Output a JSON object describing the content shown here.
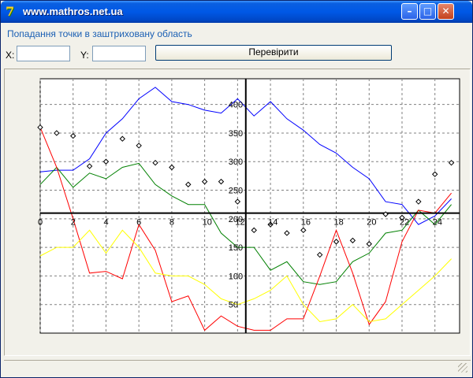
{
  "window": {
    "title": "www.mathros.net.ua",
    "icon": "app-logo-icon"
  },
  "header": {
    "caption": "Попадання точки в заштриховану область"
  },
  "form": {
    "x_label": "X:",
    "x_value": "",
    "y_label": "Y:",
    "y_value": "",
    "button_label": "Перевірити"
  },
  "colors": {
    "accent": "#0058e6",
    "caption": "#1a5fb4"
  },
  "chart_data": {
    "type": "line",
    "x_ticks": [
      "0",
      "2",
      "4",
      "6",
      "8",
      "10",
      "12",
      "14",
      "16",
      "18",
      "20",
      "22",
      "24"
    ],
    "y_ticks": [
      "50",
      "100",
      "150",
      "200",
      "250",
      "300",
      "350",
      "400"
    ],
    "xlim": [
      0,
      25.5
    ],
    "ylim": [
      0,
      445
    ],
    "x_axis_at_y": 210,
    "y_axis_at_x": 12.5,
    "grid": true,
    "x": [
      0,
      1,
      2,
      3,
      4,
      5,
      6,
      7,
      8,
      9,
      10,
      11,
      12,
      13,
      14,
      15,
      16,
      17,
      18,
      19,
      20,
      21,
      22,
      23,
      24,
      25
    ],
    "series": [
      {
        "color": "#0000ff",
        "values": [
          282,
          285,
          285,
          305,
          350,
          375,
          410,
          430,
          405,
          400,
          390,
          385,
          410,
          380,
          405,
          375,
          355,
          330,
          315,
          290,
          270,
          230,
          225,
          190,
          205,
          235
        ]
      },
      {
        "color": "#008000",
        "values": [
          260,
          290,
          255,
          280,
          270,
          290,
          297,
          260,
          240,
          225,
          225,
          175,
          150,
          150,
          110,
          125,
          90,
          85,
          90,
          125,
          140,
          175,
          180,
          215,
          190,
          225
        ]
      },
      {
        "color": "#ff0000",
        "values": [
          360,
          290,
          200,
          105,
          108,
          95,
          190,
          145,
          55,
          65,
          5,
          30,
          12,
          5,
          5,
          25,
          25,
          100,
          180,
          105,
          15,
          55,
          160,
          215,
          210,
          245
        ]
      },
      {
        "color": "#ffff00",
        "values": [
          135,
          150,
          150,
          180,
          140,
          180,
          150,
          105,
          100,
          100,
          85,
          60,
          50,
          60,
          75,
          100,
          50,
          20,
          25,
          50,
          20,
          25,
          50,
          75,
          100,
          130
        ]
      }
    ],
    "scatter": {
      "x": [
        0,
        1,
        2,
        3,
        4,
        5,
        6,
        7,
        8,
        9,
        10,
        11,
        12,
        13,
        14,
        15,
        16,
        17,
        18,
        19,
        20,
        21,
        22,
        23,
        24,
        25
      ],
      "y": [
        360,
        350,
        345,
        292,
        300,
        340,
        328,
        298,
        290,
        260,
        265,
        265,
        230,
        180,
        190,
        175,
        180,
        137,
        160,
        162,
        156,
        208,
        202,
        230,
        278,
        298
      ]
    }
  }
}
